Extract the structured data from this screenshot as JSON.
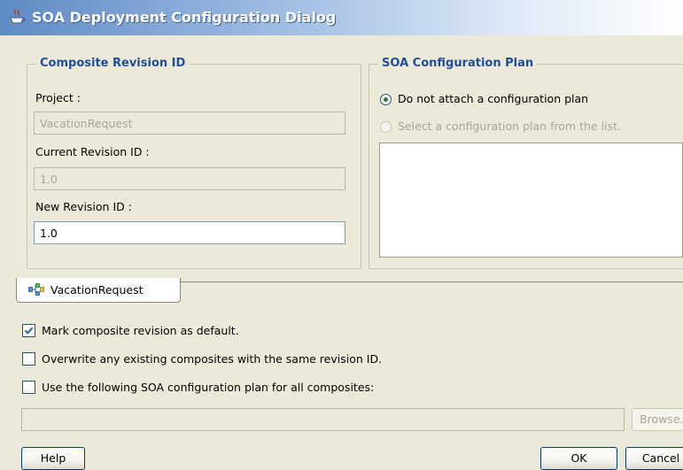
{
  "window": {
    "title": "SOA Deployment Configuration Dialog",
    "icon": "coffee-cup-icon"
  },
  "composite_revision": {
    "legend": "Composite Revision ID",
    "project_label": "Project :",
    "project_value": "VacationRequest",
    "current_label": "Current Revision ID :",
    "current_value": "1.0",
    "new_label": "New Revision ID :",
    "new_value": "1.0"
  },
  "config_plan": {
    "legend": "SOA Configuration Plan",
    "option_none": "Do not attach a configuration plan",
    "option_select": "Select a configuration plan from the list.",
    "selected": "option_none"
  },
  "tabs": [
    {
      "label": "VacationRequest",
      "icon": "composite-icon"
    }
  ],
  "options": {
    "mark_default": {
      "label": "Mark composite revision as default.",
      "checked": true
    },
    "overwrite": {
      "label": "Overwrite any existing composites with the same revision ID.",
      "checked": false
    },
    "use_plan": {
      "label": "Use the following SOA configuration plan for all composites:",
      "checked": false
    },
    "plan_path_value": "",
    "browse_label": "Browse..."
  },
  "buttons": {
    "help": "Help",
    "ok": "OK",
    "cancel": "Cancel"
  },
  "colors": {
    "legend": "#1f4e9c",
    "title_gradient_start": "#5d8bc5",
    "dialog_background": "#ece9d8"
  }
}
